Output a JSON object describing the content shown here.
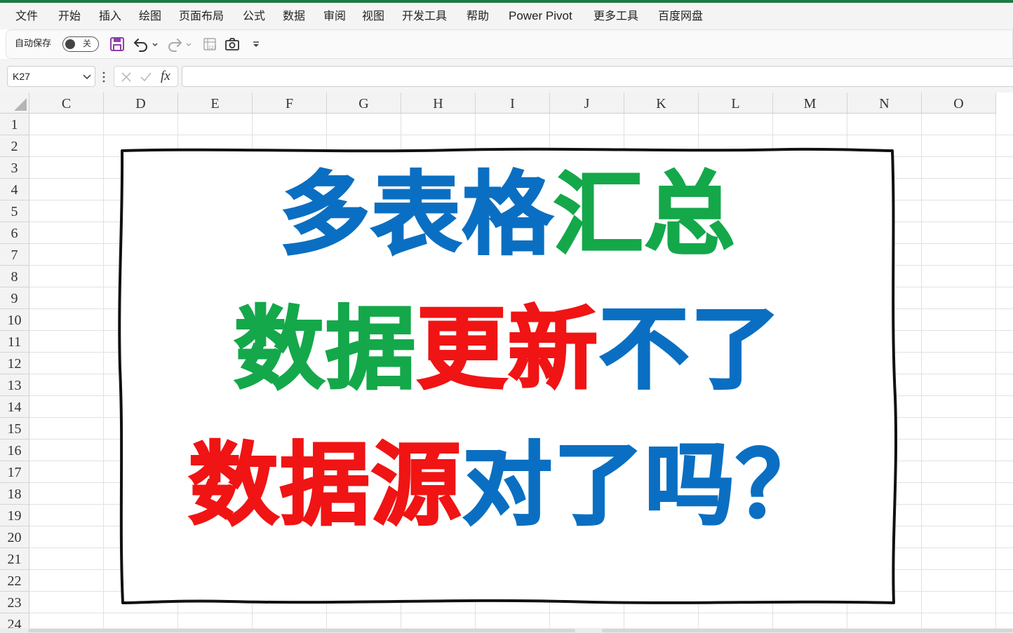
{
  "menu": {
    "items": [
      "文件",
      "开始",
      "插入",
      "绘图",
      "页面布局",
      "公式",
      "数据",
      "审阅",
      "视图",
      "开发工具",
      "帮助",
      "Power Pivot",
      "更多工具",
      "百度网盘"
    ]
  },
  "quick_access": {
    "autosave_label": "自动保存",
    "autosave_state": "关",
    "icons": [
      "save-icon",
      "undo-icon",
      "redo-icon",
      "number-format-icon",
      "camera-icon",
      "customize-icon"
    ]
  },
  "formula_bar": {
    "name_box": "K27",
    "function_label": "fx",
    "formula": ""
  },
  "grid": {
    "columns": [
      "C",
      "D",
      "E",
      "F",
      "G",
      "H",
      "I",
      "J",
      "K",
      "L",
      "M",
      "N",
      "O"
    ],
    "rows": [
      "1",
      "2",
      "3",
      "4",
      "5",
      "6",
      "7",
      "8",
      "9",
      "10",
      "11",
      "12",
      "13",
      "14",
      "15",
      "16",
      "17",
      "18",
      "19",
      "20",
      "21",
      "22",
      "23",
      "24"
    ]
  },
  "banner": {
    "lines": [
      [
        {
          "text": "多表格",
          "color": "#0a6fc2"
        },
        {
          "text": "汇总",
          "color": "#14a84a"
        }
      ],
      [
        {
          "text": "数据",
          "color": "#14a84a"
        },
        {
          "text": "更新",
          "color": "#f01414"
        },
        {
          "text": "不了",
          "color": "#0a6fc2"
        }
      ],
      [
        {
          "text": "数据源",
          "color": "#f01414"
        },
        {
          "text": "对了吗？",
          "color": "#0a6fc2"
        }
      ]
    ]
  },
  "colors": {
    "accent": "#1f7a45",
    "blue": "#0a6fc2",
    "green": "#14a84a",
    "red": "#f01414",
    "save_icon": "#8e3fa8"
  }
}
